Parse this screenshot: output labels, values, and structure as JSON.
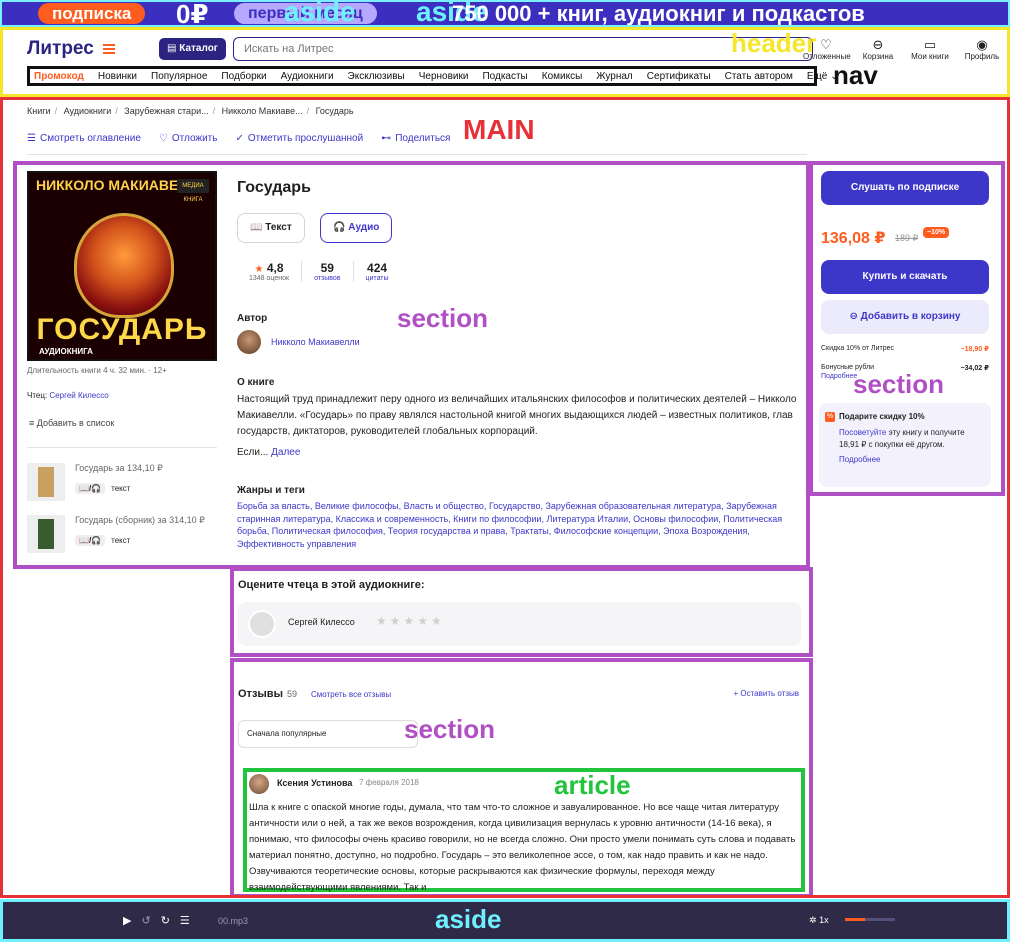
{
  "promo": {
    "pill1": "подписка",
    "zero": "0₽",
    "pill2": "первый месяц",
    "headline": "750 000 + книг, аудиокниг и подкастов",
    "tag": "aside",
    "tag2": "aside"
  },
  "header": {
    "logo": "Литрес",
    "catalog": "Каталог",
    "search_placeholder": "Искать на Литрес",
    "tag": "header",
    "icons": [
      {
        "label": "Отложенные",
        "glyph": "♡"
      },
      {
        "label": "Корзина",
        "glyph": "⊖"
      },
      {
        "label": "Мои книги",
        "glyph": "▭"
      },
      {
        "label": "Профиль",
        "glyph": "◉"
      }
    ]
  },
  "nav": {
    "tag": "nav",
    "items": [
      "Промокод",
      "Новинки",
      "Популярное",
      "Подборки",
      "Аудиокниги",
      "Эксклюзивы",
      "Черновики",
      "Подкасты",
      "Комиксы",
      "Журнал",
      "Сертификаты",
      "Стать автором",
      "Ещё ⌄"
    ]
  },
  "main": {
    "tag": "MAIN",
    "breadcrumbs": [
      "Книги",
      "Аудиокниги",
      "Зарубежная стари...",
      "Никколо Макиаве...",
      "Государь"
    ],
    "actions": [
      {
        "icon": "☰",
        "label": "Смотреть оглавление"
      },
      {
        "icon": "♡",
        "label": "Отложить"
      },
      {
        "icon": "✓",
        "label": "Отметить прослушанной"
      },
      {
        "icon": "⊷",
        "label": "Поделиться"
      }
    ]
  },
  "book": {
    "section_tag": "section",
    "cover": {
      "author_top": "НИККОЛО МАКИАВЕЛЛИ",
      "title_big": "ГОСУДАРЬ",
      "subtitle": "АУДИОКНИГА",
      "badge": "МЕДИА КНИГА"
    },
    "duration": "Длительность книги 4 ч. 32 мин. · 12+",
    "reader_label": "Чтец:",
    "reader_name": "Сергей Килессо",
    "add_to_list": "Добавить в список",
    "variants": [
      {
        "title": "Государь за 134,10 ₽",
        "format": "📖/🎧",
        "kind": "текст"
      },
      {
        "title": "Государь (сборник) за 314,10 ₽",
        "format": "📖/🎧",
        "kind": "текст"
      }
    ],
    "title": "Государь",
    "formats": [
      "Текст",
      "Аудио"
    ],
    "rating": "4,8",
    "rating_count": "1348 оценок",
    "reviews": "59",
    "reviews_label": "отзывов",
    "quotes": "424",
    "quotes_label": "цитаты",
    "author_heading": "Автор",
    "author_name": "Никколо Макиавелли",
    "about_heading": "О книге",
    "about_text": "Настоящий труд принадлежит перу одного из величайших итальянских философов и политических деятелей – Никколо Макиавелли. «Государь» по праву являлся настольной книгой многих выдающихся людей – известных политиков, глав государств, диктаторов, руководителей глобальных корпораций.",
    "more_prefix": "Если...",
    "more_link": "Далее",
    "genres_heading": "Жанры и теги",
    "genres": "Борьба за власть, Великие философы, Власть и общество, Государство, Зарубежная образовательная литература, Зарубежная старинная литература, Классика и современность, Книги по философии, Литература Италии, Основы философии, Политическая борьба, Политическая философия, Теория государства и права, Трактаты, Философские концепции, Эпоха Возрождения, Эффективность управления"
  },
  "buy": {
    "section_tag": "section",
    "listen": "Слушать по подписке",
    "price": "136,08 ₽",
    "old_price": "189 ₽",
    "discount": "−10%",
    "buy": "Купить и скачать",
    "cart": "Добавить в корзину",
    "disc_label": "Скидка 10% от Литрес",
    "disc_value": "−18,90 ₽",
    "bonus_label": "Бонусные рубли",
    "bonus_value": "−34,02 ₽",
    "bonus_more": "Подробнее",
    "gift_title": "Подарите скидку 10%",
    "gift_link": "Посоветуйте",
    "gift_text": " эту книгу и получите 18,91 ₽ с покупки её другом.",
    "gift_more": "Подробнее"
  },
  "rate": {
    "section_tag": "section",
    "title": "Оцените чтеца в этой аудиокниге:",
    "reader": "Сергей Килессо",
    "stars": "★★★★★"
  },
  "reviews": {
    "section_tag": "section",
    "title": "Отзывы",
    "count": "59",
    "all": "Смотреть все отзывы",
    "add": "+ Оставить отзыв",
    "sort": "Сначала популярные",
    "article_tag": "article",
    "review": {
      "author": "Ксения Устинова",
      "date": "7 февраля 2018",
      "text": "Шла к книге с опаской многие годы, думала, что там что-то сложное и завуалированное. Но все чаще читая литературу античности или о ней, а так же веков возрождения, когда цивилизация вернулась к уровню античности (14-16 века), я понимаю, что философы очень красиво говорили, но не всегда сложно. Они просто умели понимать суть слова и подавать материал понятно, доступно, но подробно. Государь – это великолепное эссе, о том, как надо править и как не надо. Озвучиваются теоретические основы, которые раскрываются как физические формулы, переходя между взаимодействующими явлениями. Так и"
    }
  },
  "player": {
    "file": "00.mp3",
    "speed": "1x",
    "tag": "aside",
    "volume": 0.4
  }
}
